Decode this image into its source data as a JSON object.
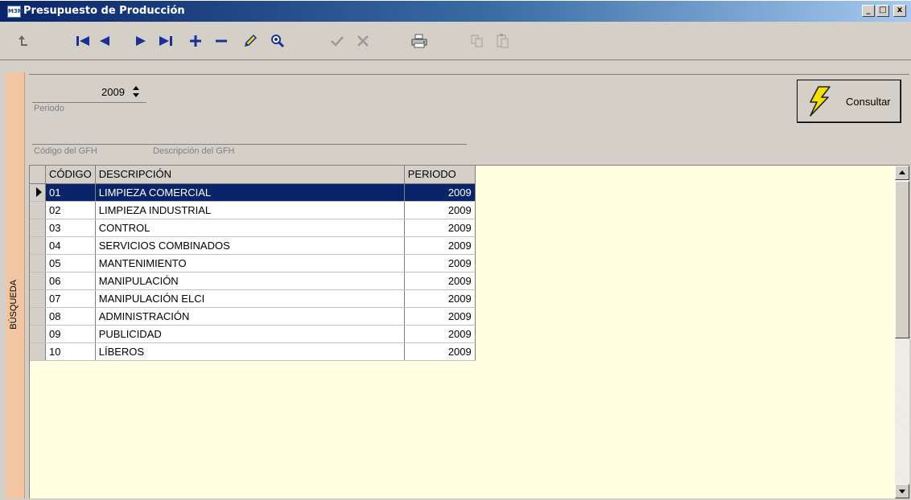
{
  "window": {
    "title": "Presupuesto de Producción",
    "icon_text": "M3M",
    "minimize": "_",
    "maximize": "□",
    "close": "x"
  },
  "toolbar": {
    "icons": [
      "exit-icon",
      "first-record-icon",
      "prior-record-icon",
      "next-record-icon",
      "last-record-icon",
      "add-icon",
      "delete-icon",
      "edit-icon",
      "search-icon",
      "confirm-icon",
      "cancel-icon",
      "print-icon",
      "copy-icon",
      "paste-icon"
    ]
  },
  "sidetab": {
    "label": "BÚSQUEDA"
  },
  "filter": {
    "year": "2009",
    "year_label": "Periodo",
    "code_label": "Código del GFH",
    "desc_label": "Descripción del GFH",
    "consult_button": "Consultar"
  },
  "grid": {
    "columns": [
      "CÓDIGO",
      "DESCRIPCIÓN",
      "PERIODO"
    ],
    "rows": [
      {
        "code": "01",
        "desc": "LIMPIEZA COMERCIAL",
        "period": "2009"
      },
      {
        "code": "02",
        "desc": "LIMPIEZA INDUSTRIAL",
        "period": "2009"
      },
      {
        "code": "03",
        "desc": "CONTROL",
        "period": "2009"
      },
      {
        "code": "04",
        "desc": "SERVICIOS COMBINADOS",
        "period": "2009"
      },
      {
        "code": "05",
        "desc": "MANTENIMIENTO",
        "period": "2009"
      },
      {
        "code": "06",
        "desc": "MANIPULACIÓN",
        "period": "2009"
      },
      {
        "code": "07",
        "desc": "MANIPULACIÓN ELCI",
        "period": "2009"
      },
      {
        "code": "08",
        "desc": "ADMINISTRACIÓN",
        "period": "2009"
      },
      {
        "code": "09",
        "desc": "PUBLICIDAD",
        "period": "2009"
      },
      {
        "code": "10",
        "desc": "LÍBEROS",
        "period": "2009"
      }
    ]
  },
  "colors": {
    "title_bar": "#0a246a",
    "selection": "#0a246a",
    "sidetab": "#f2c6a2",
    "grid_bg": "#ffffe1",
    "toolbar_icon": "#1a2f9a"
  }
}
